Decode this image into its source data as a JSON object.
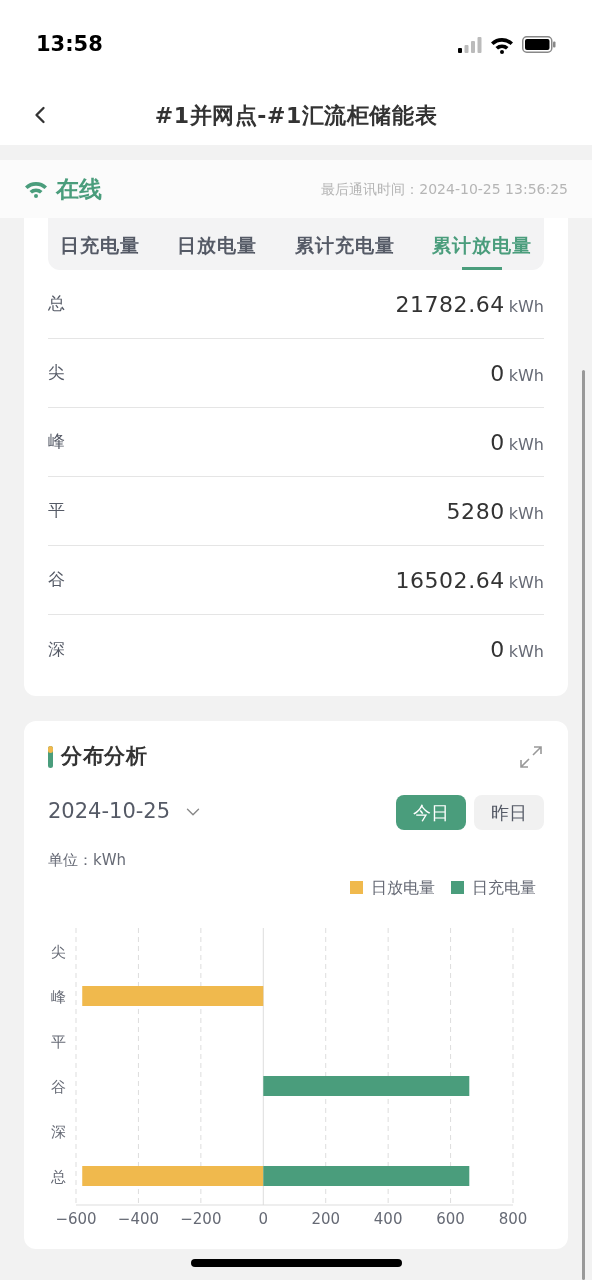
{
  "status_bar": {
    "time": "13:58"
  },
  "header": {
    "title": "#1并网点-#1汇流柜储能表"
  },
  "connection": {
    "status": "在线",
    "online": true,
    "last_comm": "最后通讯时间：2024-10-25 13:56:25"
  },
  "tabs": [
    {
      "label": "日充电量",
      "selected": false
    },
    {
      "label": "日放电量",
      "selected": false
    },
    {
      "label": "累计充电量",
      "selected": false
    },
    {
      "label": "累计放电量",
      "selected": true
    }
  ],
  "rows": [
    {
      "label": "总",
      "value": "21782.64",
      "unit": "kWh"
    },
    {
      "label": "尖",
      "value": "0",
      "unit": "kWh"
    },
    {
      "label": "峰",
      "value": "0",
      "unit": "kWh"
    },
    {
      "label": "平",
      "value": "5280",
      "unit": "kWh"
    },
    {
      "label": "谷",
      "value": "16502.64",
      "unit": "kWh"
    },
    {
      "label": "深",
      "value": "0",
      "unit": "kWh"
    }
  ],
  "analysis": {
    "title": "分布分析",
    "date": "2024-10-25",
    "periods": [
      {
        "label": "今日",
        "selected": true
      },
      {
        "label": "昨日",
        "selected": false
      }
    ],
    "unit_label": "单位：kWh",
    "chart_data": {
      "type": "bar",
      "orientation": "horizontal",
      "stacked": true,
      "grid": true,
      "categories": [
        "尖",
        "峰",
        "平",
        "谷",
        "深",
        "总"
      ],
      "series": [
        {
          "name": "日放电量",
          "color": "#f0b94d",
          "values": [
            0,
            -580,
            0,
            0,
            0,
            -580
          ]
        },
        {
          "name": "日充电量",
          "color": "#4a9d7c",
          "values": [
            0,
            0,
            0,
            660,
            0,
            660
          ]
        }
      ],
      "xlim": [
        -600,
        800
      ],
      "xticks": [
        {
          "value": -600,
          "label": "−600"
        },
        {
          "value": -400,
          "label": "−400"
        },
        {
          "value": -200,
          "label": "−200"
        },
        0,
        200,
        400,
        600,
        800
      ]
    }
  }
}
